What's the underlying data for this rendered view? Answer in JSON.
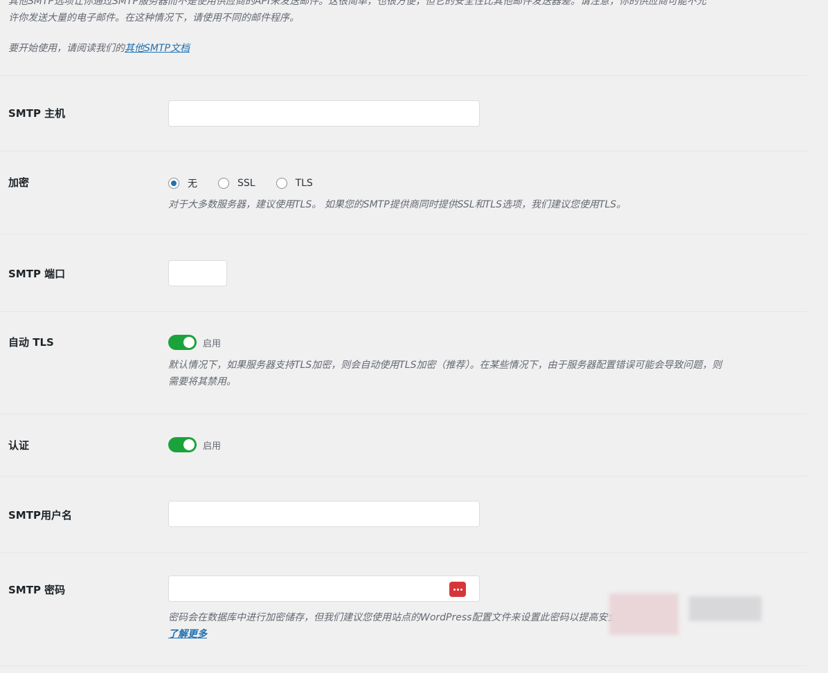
{
  "intro": {
    "line1": "其他SMTP选项让你通过SMTP服务器而不是使用供应商的API来发送邮件。这很简单，也很方便，但它的安全性比其他邮件发送器差。请注意，你的供应商可能不允",
    "line2": "许你发送大量的电子邮件。在这种情况下，请使用不同的邮件程序。",
    "start_text": "要开始使用，请阅读我们的",
    "doc_link": "其他SMTP文档"
  },
  "smtp_host": {
    "label": "SMTP 主机",
    "value": ""
  },
  "encryption": {
    "label": "加密",
    "options": [
      "无",
      "SSL",
      "TLS"
    ],
    "selected": "无",
    "description": "对于大多数服务器，建议使用TLS。 如果您的SMTP提供商同时提供SSL和TLS选项，我们建议您使用TLS。"
  },
  "smtp_port": {
    "label": "SMTP 端口",
    "value": ""
  },
  "auto_tls": {
    "label": "自动 TLS",
    "toggle_label": "启用",
    "enabled": true,
    "description_line1": "默认情况下，如果服务器支持TLS加密，则会自动使用TLS加密（推荐）。在某些情况下，由于服务器配置错误可能会导致问题，则",
    "description_line2": "需要将其禁用。"
  },
  "auth": {
    "label": "认证",
    "toggle_label": "启用",
    "enabled": true
  },
  "smtp_username": {
    "label": "SMTP用户名",
    "value": ""
  },
  "smtp_password": {
    "label": "SMTP 密码",
    "value": "",
    "icon": "password-manager-icon",
    "description": "密码会在数据库中进行加密储存，但我们建议您使用站点的WordPress配置文件来设置此密码以提高安全性。",
    "learn_more": "了解更多"
  },
  "colors": {
    "toggle_on": "#1aa33a",
    "link": "#2271b1",
    "radio_checked": "#2271b1",
    "pw_icon": "#d63638"
  }
}
